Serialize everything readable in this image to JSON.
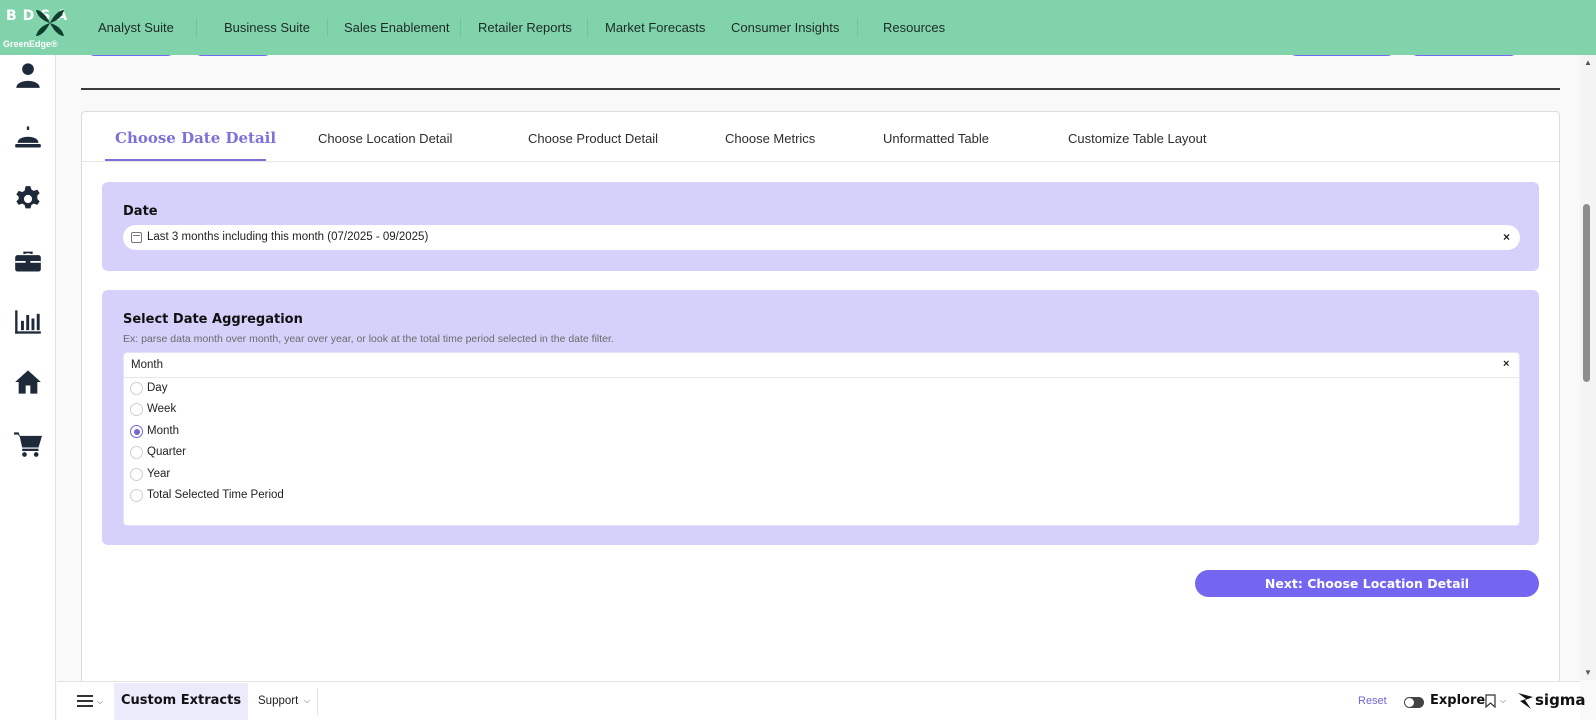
{
  "logo": {
    "letters": "BDSA",
    "brand": "GreenEdge®"
  },
  "nav": {
    "items": [
      "Analyst Suite",
      "Business Suite",
      "Sales Enablement",
      "Retailer Reports",
      "Market Forecasts",
      "Consumer Insights",
      "Resources"
    ]
  },
  "sidebar": {
    "icons": [
      "user-icon",
      "bell-icon",
      "gear-icon",
      "briefcase-icon",
      "bar-chart-icon",
      "home-icon",
      "cart-icon"
    ]
  },
  "tabs": {
    "active": "Choose Date Detail",
    "items": [
      "Choose Date Detail",
      "Choose Location Detail",
      "Choose Product Detail",
      "Choose Metrics",
      "Unformatted Table",
      "Customize Table Layout"
    ]
  },
  "date_card": {
    "title": "Date",
    "value": "Last 3 months including this month (07/2025 - 09/2025)",
    "clear": "×"
  },
  "agg_card": {
    "title": "Select Date Aggregation",
    "subtitle": "Ex: parse data month over month, year over year, or look at the total time period selected in the date filter.",
    "selected": "Month",
    "clear": "×",
    "options": [
      "Day",
      "Week",
      "Month",
      "Quarter",
      "Year",
      "Total Selected Time Period"
    ]
  },
  "next_button": "Next: Choose Location Detail",
  "bottom": {
    "workbook_title": "Custom Extracts",
    "support": "Support",
    "reset": "Reset",
    "explore": "Explore",
    "brand": "sigma"
  },
  "colors": {
    "nav_bg": "#81d3ab",
    "accent": "#7466f0",
    "card_bg": "#d5d1fb",
    "active_tab": "#7b72d9"
  }
}
